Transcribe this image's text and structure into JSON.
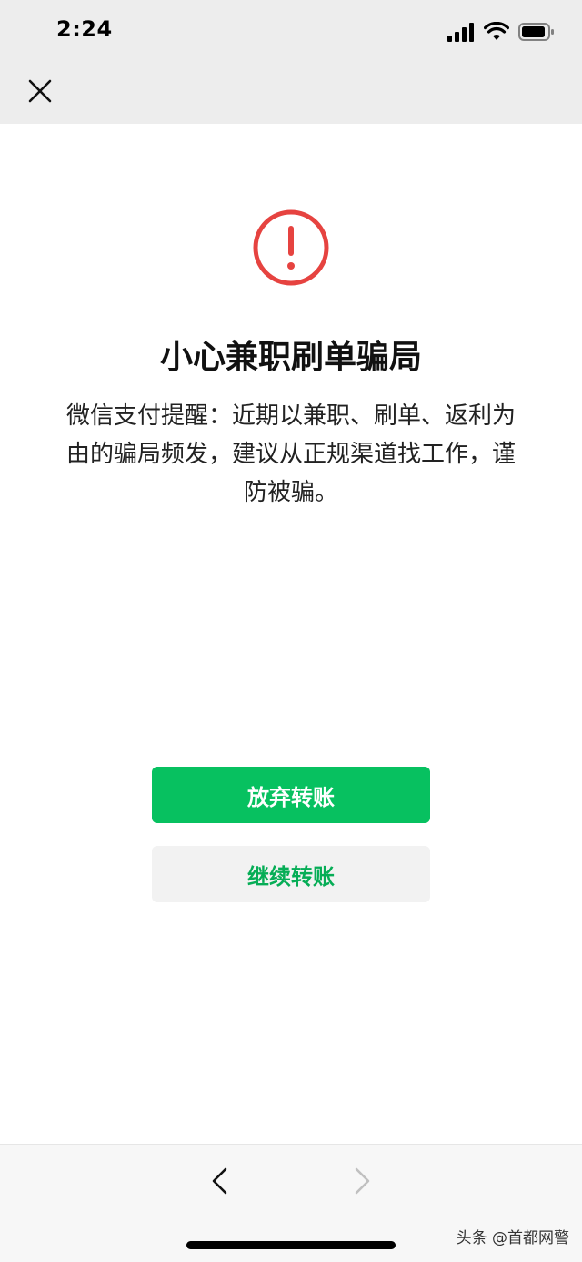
{
  "status_bar": {
    "time": "2:24"
  },
  "nav": {
    "close_icon": "close-icon"
  },
  "alert": {
    "icon": "exclamation-circle-icon",
    "icon_color": "#e64340",
    "title": "小心兼职刷单骗局",
    "message": "微信支付提醒：近期以兼职、刷单、返利为由的骗局频发，建议从正规渠道找工作，谨防被骗。"
  },
  "actions": {
    "primary_label": "放弃转账",
    "secondary_label": "继续转账",
    "primary_color": "#07c160",
    "secondary_text_color": "#06ad56"
  },
  "toolbar": {
    "back_icon": "chevron-left-icon",
    "forward_icon": "chevron-right-icon"
  },
  "watermark": {
    "text": "头条 @首都网警"
  }
}
